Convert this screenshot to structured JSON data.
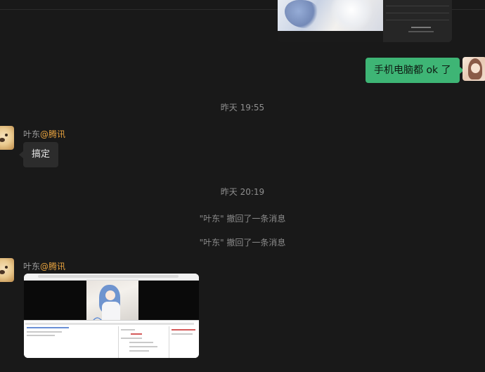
{
  "chat": {
    "messages": [
      {
        "type": "image",
        "from": "me",
        "description": "screenshot"
      },
      {
        "type": "text",
        "from": "me",
        "text": "手机电脑都 ok 了"
      },
      {
        "type": "time",
        "text": "昨天 19:55"
      },
      {
        "type": "text",
        "from": "other",
        "sender_name": "叶东",
        "sender_org": "@腾讯",
        "text": "搞定"
      },
      {
        "type": "time",
        "text": "昨天 20:19"
      },
      {
        "type": "system",
        "text": "\"叶东\" 撤回了一条消息"
      },
      {
        "type": "system",
        "text": "\"叶东\" 撤回了一条消息"
      },
      {
        "type": "image",
        "from": "other",
        "sender_name": "叶东",
        "sender_org": "@腾讯",
        "description": "screenshot"
      }
    ]
  },
  "colors": {
    "background": "#191919",
    "my_bubble": "#3eb575",
    "other_bubble": "#2c2c2c",
    "org_accent": "#e7a23e"
  }
}
